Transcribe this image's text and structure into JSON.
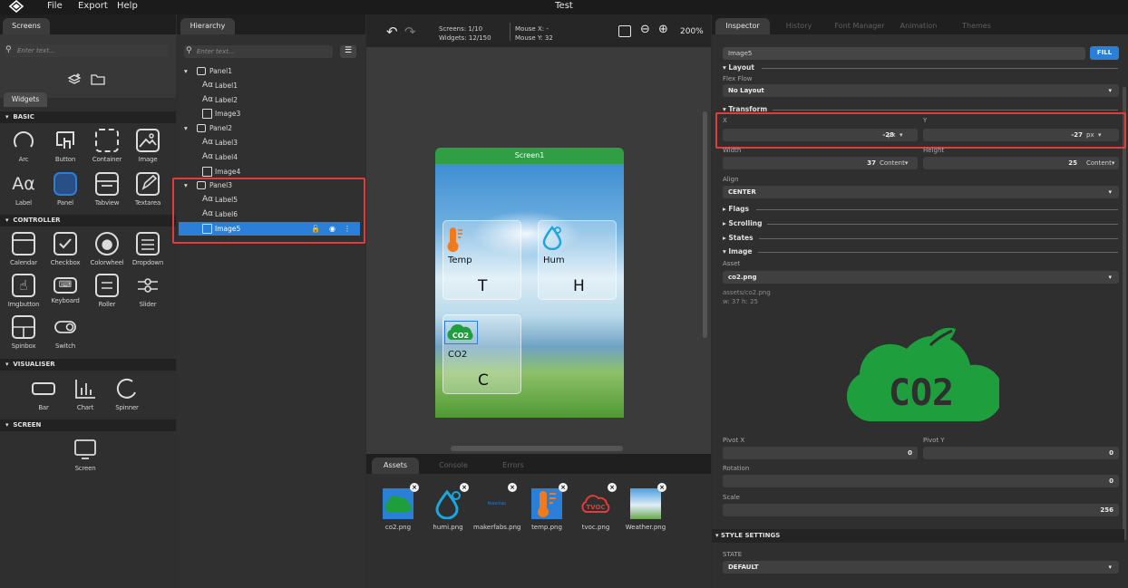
{
  "app": {
    "title": "Test",
    "menu": [
      "File",
      "Export",
      "Help"
    ]
  },
  "screens_panel": {
    "tab_label": "Screens",
    "search_placeholder": "Enter text...",
    "widgets_tab": "Widgets",
    "sections": [
      {
        "title": "BASIC",
        "items": [
          "Arc",
          "Button",
          "Container",
          "Image",
          "Label",
          "Panel",
          "Tabview",
          "Textarea"
        ]
      },
      {
        "title": "CONTROLLER",
        "items": [
          "Calendar",
          "Checkbox",
          "Colorwheel",
          "Dropdown",
          "Imgbutton",
          "Keyboard",
          "Roller",
          "Slider",
          "Spinbox",
          "Switch"
        ]
      },
      {
        "title": "VISUALISER",
        "items": [
          "Bar",
          "Chart",
          "Spinner"
        ]
      },
      {
        "title": "SCREEN",
        "items": [
          "Screen"
        ]
      }
    ]
  },
  "hierarchy": {
    "tab_label": "Hierarchy",
    "search_placeholder": "Enter text...",
    "rows": [
      {
        "label": "Panel1",
        "type": "panel"
      },
      {
        "label": "Label1",
        "type": "label"
      },
      {
        "label": "Label2",
        "type": "label"
      },
      {
        "label": "Image3",
        "type": "image"
      },
      {
        "label": "Panel2",
        "type": "panel"
      },
      {
        "label": "Label3",
        "type": "label"
      },
      {
        "label": "Label4",
        "type": "label"
      },
      {
        "label": "Image4",
        "type": "image"
      },
      {
        "label": "Panel3",
        "type": "panel"
      },
      {
        "label": "Label5",
        "type": "label"
      },
      {
        "label": "Label6",
        "type": "label"
      },
      {
        "label": "Image5",
        "type": "image",
        "selected": true
      }
    ]
  },
  "canvas": {
    "screens_label": "Screens:",
    "screens_value": "1/10",
    "widgets_label": "Widgets:",
    "widgets_value": "12/150",
    "mousex_label": "Mouse X:",
    "mousex_value": "-",
    "mousey_label": "Mouse Y:",
    "mousey_value": "32",
    "zoom": "200%",
    "screen_title": "Screen1",
    "cards": [
      {
        "title": "Temp",
        "letter": "T"
      },
      {
        "title": "Hum",
        "letter": "H"
      },
      {
        "title": "CO2",
        "letter": "C"
      }
    ],
    "co2_icon_text": "CO2"
  },
  "bottom_panel": {
    "tabs": [
      "Assets",
      "Console",
      "Errors"
    ],
    "assets": [
      {
        "name": "co2.png"
      },
      {
        "name": "humi.png"
      },
      {
        "name": "makerfabs.png"
      },
      {
        "name": "temp.png"
      },
      {
        "name": "tvoc.png"
      },
      {
        "name": "Weather.png"
      }
    ],
    "makerfabs_logo_text": "Makerfabs",
    "tvoc_icon_text": "TVOC"
  },
  "inspector": {
    "tabs": [
      "Inspector",
      "History",
      "Font Manager",
      "Animation",
      "Themes"
    ],
    "name_value": "Image5",
    "fill_button": "FILL",
    "layout_header": "Layout",
    "flex_flow_label": "Flex Flow",
    "flex_flow_value": "No Layout",
    "transform_header": "Transform",
    "x_label": "X",
    "x_value": "-28",
    "x_unit": "px",
    "y_label": "Y",
    "y_value": "-27",
    "y_unit": "px",
    "width_label": "Width",
    "width_value": "37",
    "width_unit": "Content",
    "height_label": "Height",
    "height_value": "25",
    "height_unit": "Content",
    "align_label": "Align",
    "align_value": "CENTER",
    "flags_header": "Flags",
    "scrolling_header": "Scrolling",
    "states_header": "States",
    "image_header": "Image",
    "asset_label": "Asset",
    "asset_value": "co2.png",
    "asset_path": "assets/co2.png",
    "asset_dims": "w: 37  h: 25",
    "preview_text": "CO2",
    "pivot_x_label": "Pivot X",
    "pivot_x_value": "0",
    "pivot_y_label": "Pivot Y",
    "pivot_y_value": "0",
    "rotation_label": "Rotation",
    "rotation_value": "0",
    "scale_label": "Scale",
    "scale_value": "256",
    "style_header": "STYLE SETTINGS",
    "state_label": "STATE",
    "state_value": "DEFAULT"
  },
  "colors": {
    "accent": "#2b7fd6",
    "highlight": "#e23b3b",
    "co2_green": "#1f9e3e",
    "screen_title_bar": "#2f9e45"
  }
}
